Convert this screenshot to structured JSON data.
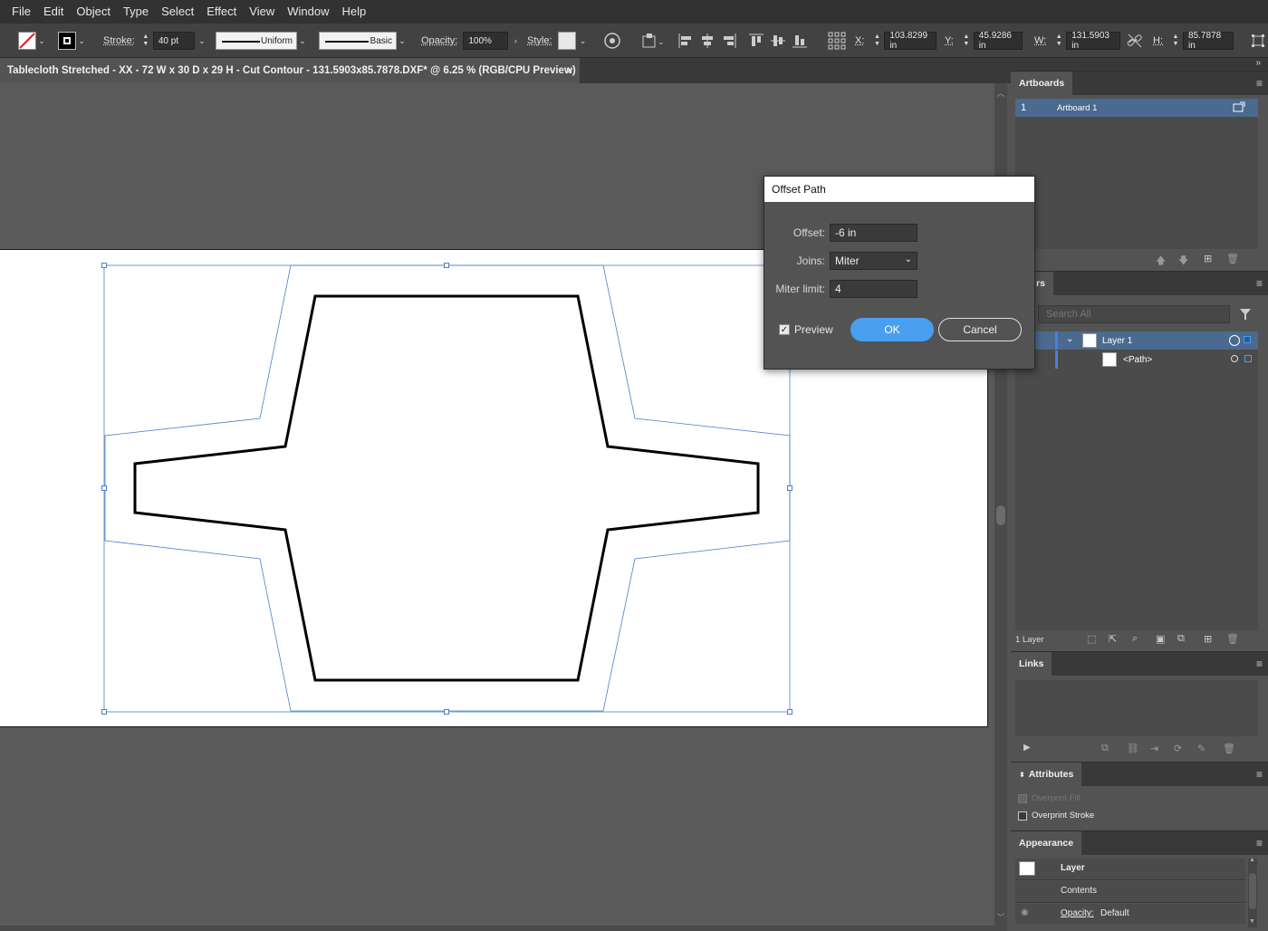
{
  "menu": [
    "File",
    "Edit",
    "Object",
    "Type",
    "Select",
    "Effect",
    "View",
    "Window",
    "Help"
  ],
  "control": {
    "stroke_label": "Stroke:",
    "stroke_value": "40 pt",
    "profile_uniform": "Uniform",
    "brush_basic": "Basic",
    "opacity_label": "Opacity:",
    "opacity_value": "100%",
    "style_label": "Style:",
    "x_label": "X:",
    "x_value": "103.8299 in",
    "y_label": "Y:",
    "y_value": "45.9286 in",
    "w_label": "W:",
    "w_value": "131.5903 in",
    "h_label": "H:",
    "h_value": "85.7878 in"
  },
  "document": {
    "tab_title": "Tablecloth Stretched - XX - 72 W x 30 D x 29 H - Cut Contour - 131.5903x85.7878.DXF* @ 6.25 % (RGB/CPU Preview)",
    "close": "×"
  },
  "dialog": {
    "title": "Offset Path",
    "offset_label": "Offset:",
    "offset_value": "-6 in",
    "joins_label": "Joins:",
    "joins_value": "Miter",
    "miter_label": "Miter limit:",
    "miter_value": "4",
    "preview_label": "Preview",
    "preview_checked": true,
    "ok_label": "OK",
    "cancel_label": "Cancel"
  },
  "panels": {
    "artboards": {
      "title": "Artboards",
      "items": [
        {
          "index": "1",
          "name": "Artboard 1"
        }
      ]
    },
    "layers": {
      "title": "rs",
      "search_placeholder": "Search All",
      "layer_name": "Layer 1",
      "path_name": "<Path>",
      "footer_count": "1 Layer"
    },
    "links": {
      "title": "Links"
    },
    "attributes": {
      "title": "Attributes",
      "overprint_fill": "Overprint Fill",
      "overprint_stroke": "Overprint Stroke"
    },
    "appearance": {
      "title": "Appearance",
      "layer_label": "Layer",
      "contents_label": "Contents",
      "opacity_label": "Opacity:",
      "opacity_value": "Default"
    }
  },
  "colors": {
    "accent": "#4a9ef0",
    "selection": "#4a7fc1",
    "panel_bg": "#535353",
    "dark_bg": "#323232"
  }
}
